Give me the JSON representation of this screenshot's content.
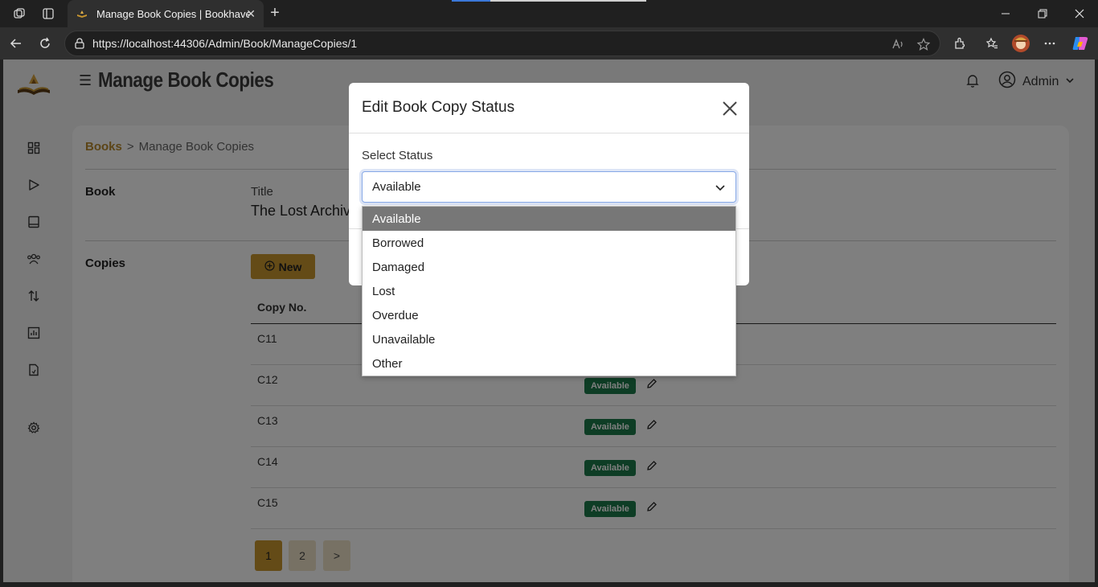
{
  "browser": {
    "tab_title": "Manage Book Copies | Bookhaven",
    "url": "https://localhost:44306/Admin/Book/ManageCopies/1"
  },
  "header": {
    "page_title": "Manage Book Copies",
    "user_name": "Admin"
  },
  "breadcrumb": {
    "parent": "Books",
    "separator": ">",
    "current": "Manage Book Copies"
  },
  "book": {
    "section_label": "Book",
    "title_label": "Title",
    "title_value": "The Lost Archiv"
  },
  "copies": {
    "section_label": "Copies",
    "new_button": "New",
    "column_header": "Copy No.",
    "rows": [
      {
        "copy": "C11",
        "status": ""
      },
      {
        "copy": "C12",
        "status": "Available"
      },
      {
        "copy": "C13",
        "status": "Available"
      },
      {
        "copy": "C14",
        "status": "Available"
      },
      {
        "copy": "C15",
        "status": "Available"
      }
    ]
  },
  "pagination": {
    "pages": [
      "1",
      "2",
      ">"
    ],
    "active": "1"
  },
  "modal": {
    "title": "Edit Book Copy Status",
    "field_label": "Select Status",
    "selected_value": "Available",
    "options": [
      "Available",
      "Borrowed",
      "Damaged",
      "Lost",
      "Overdue",
      "Unavailable",
      "Other"
    ]
  },
  "colors": {
    "accent_gold": "#c9962f",
    "badge_green": "#1d7a4a",
    "selected_option_bg": "#777777"
  }
}
